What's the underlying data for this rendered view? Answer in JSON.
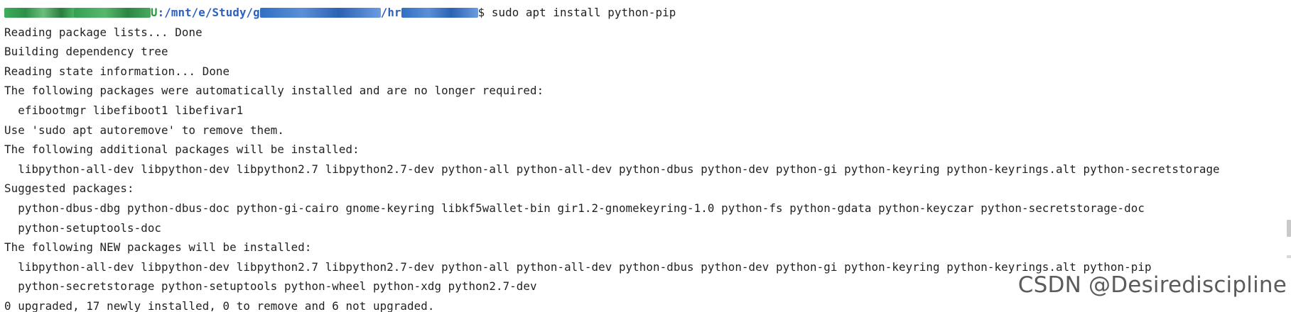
{
  "prompt": {
    "user_suffix": "U",
    "path_visible": ":/mnt/e/Study/g",
    "path_mid": "/hr",
    "dollar": "$",
    "command": " sudo apt install python-pip"
  },
  "output_lines": [
    "Reading package lists... Done",
    "Building dependency tree",
    "Reading state information... Done",
    "The following packages were automatically installed and are no longer required:",
    "  efibootmgr libefiboot1 libefivar1",
    "Use 'sudo apt autoremove' to remove them.",
    "The following additional packages will be installed:",
    "  libpython-all-dev libpython-dev libpython2.7 libpython2.7-dev python-all python-all-dev python-dbus python-dev python-gi python-keyring python-keyrings.alt python-secretstorage",
    "Suggested packages:",
    "  python-dbus-dbg python-dbus-doc python-gi-cairo gnome-keyring libkf5wallet-bin gir1.2-gnomekeyring-1.0 python-fs python-gdata python-keyczar python-secretstorage-doc",
    "  python-setuptools-doc",
    "The following NEW packages will be installed:",
    "  libpython-all-dev libpython-dev libpython2.7 libpython2.7-dev python-all python-all-dev python-dbus python-dev python-gi python-keyring python-keyrings.alt python-pip",
    "  python-secretstorage python-setuptools python-wheel python-xdg python2.7-dev",
    "0 upgraded, 17 newly installed, 0 to remove and 6 not upgraded."
  ],
  "watermark": "CSDN @Desirediscipline",
  "colors": {
    "background": "#ffffff",
    "text": "#1f1f1f",
    "prompt_user": "#2a9a3f",
    "prompt_path": "#2c5fbf",
    "watermark": "#5b5b5b"
  }
}
